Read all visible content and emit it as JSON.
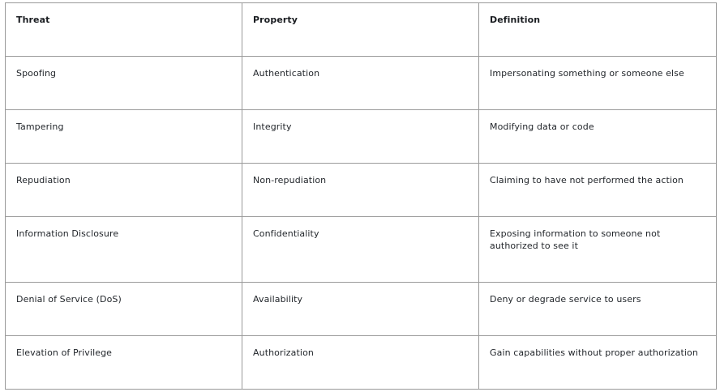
{
  "table": {
    "headers": [
      "Threat",
      "Property",
      "Definition"
    ],
    "rows": [
      {
        "threat": "Spoofing",
        "property": "Authentication",
        "definition": "Impersonating something or someone else"
      },
      {
        "threat": "Tampering",
        "property": "Integrity",
        "definition": "Modifying data or code"
      },
      {
        "threat": "Repudiation",
        "property": "Non-repudiation",
        "definition": "Claiming to have not performed the action"
      },
      {
        "threat": "Information Disclosure",
        "property": "Confidentiality",
        "definition": "Exposing information to someone not authorized to see it"
      },
      {
        "threat": "Denial of Service (DoS)",
        "property": "Availability",
        "definition": "Deny or degrade service to users"
      },
      {
        "threat": "Elevation of Privilege",
        "property": "Authorization",
        "definition": "Gain capabilities without proper authorization"
      }
    ]
  }
}
